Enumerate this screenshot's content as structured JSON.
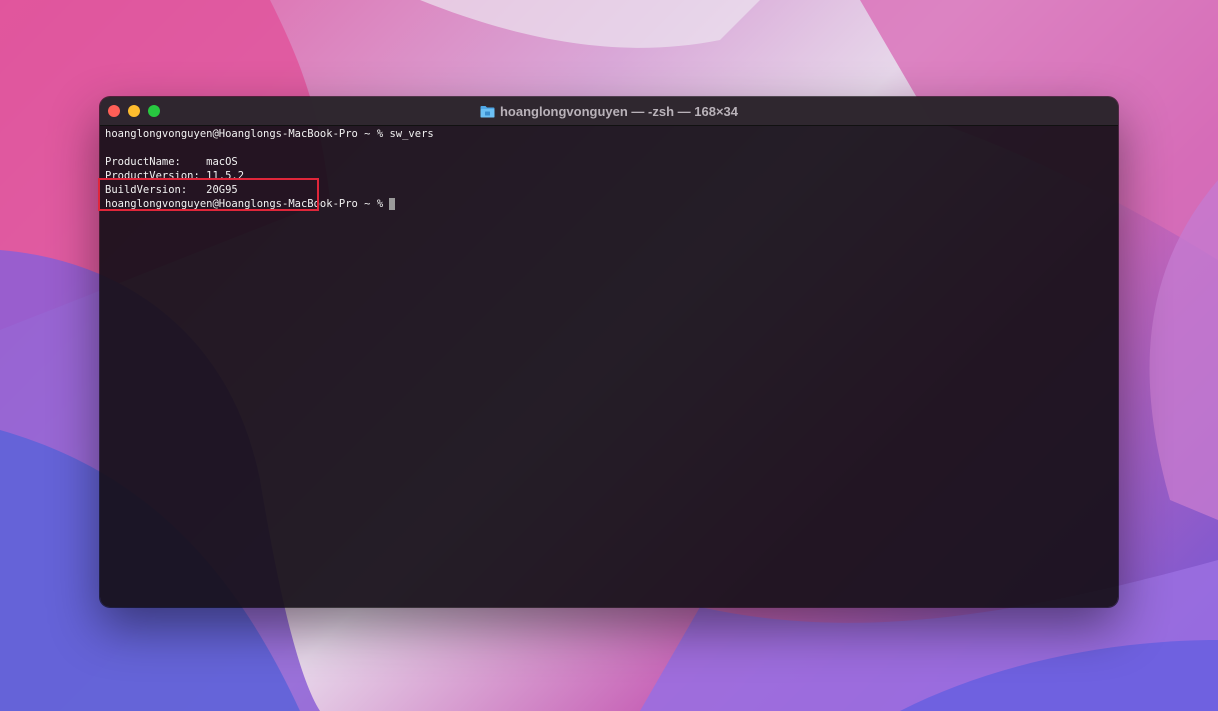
{
  "window": {
    "title": "hoanglongvonguyen — -zsh — 168×34",
    "title_icon": "folder-icon"
  },
  "terminal": {
    "lines": [
      "hoanglongvonguyen@Hoanglongs-MacBook-Pro ~ % sw_vers",
      "",
      "ProductName:    macOS",
      "ProductVersion: 11.5.2",
      "BuildVersion:   20G95",
      "hoanglongvonguyen@Hoanglongs-MacBook-Pro ~ % "
    ]
  },
  "colors": {
    "highlight_border": "#e0263a",
    "close": "#ff5f57",
    "minimize": "#febc2e",
    "zoom": "#28c840"
  }
}
